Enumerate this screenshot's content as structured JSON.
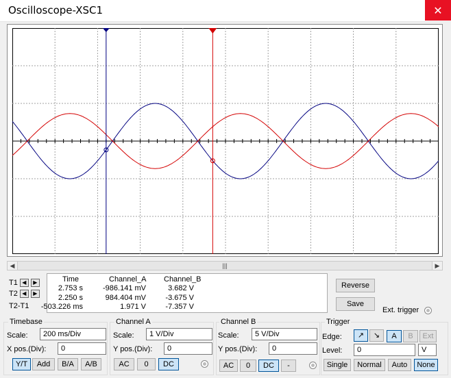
{
  "window": {
    "title": "Oscilloscope-XSC1",
    "close_glyph": "✕"
  },
  "colors": {
    "channel_a": "#000080",
    "channel_b": "#d40000",
    "cursor_1": "#000080",
    "cursor_2": "#d40000",
    "grid": "#a0a0a0",
    "close": "#e81123"
  },
  "cursors": {
    "t1_label": "T1",
    "t2_label": "T2",
    "diff_label": "T2-T1"
  },
  "measure": {
    "headers": [
      "Time",
      "Channel_A",
      "Channel_B"
    ],
    "rows": [
      [
        "2.753 s",
        "-986.141 mV",
        "3.682 V"
      ],
      [
        "2.250 s",
        "984.404 mV",
        "-3.675 V"
      ],
      [
        "-503.226 ms",
        "1.971 V",
        "-7.357 V"
      ]
    ]
  },
  "buttons": {
    "reverse": "Reverse",
    "save": "Save",
    "ext_trigger": "Ext. trigger"
  },
  "timebase": {
    "title": "Timebase",
    "scale_label": "Scale:",
    "scale_value": "200 ms/Div",
    "xpos_label": "X pos.(Div):",
    "xpos_value": "0",
    "modes": [
      "Y/T",
      "Add",
      "B/A",
      "A/B"
    ],
    "active_mode": "Y/T"
  },
  "channel_a": {
    "title": "Channel A",
    "scale_label": "Scale:",
    "scale_value": "1  V/Div",
    "ypos_label": "Y pos.(Div):",
    "ypos_value": "0",
    "coupling": [
      "AC",
      "0",
      "DC"
    ],
    "active": "DC"
  },
  "channel_b": {
    "title": "Channel B",
    "scale_label": "Scale:",
    "scale_value": "5  V/Div",
    "ypos_label": "Y pos.(Div):",
    "ypos_value": "0",
    "coupling": [
      "AC",
      "0",
      "DC",
      "-"
    ],
    "active": "DC"
  },
  "trigger": {
    "title": "Trigger",
    "edge_label": "Edge:",
    "edge_sources": [
      "A",
      "B",
      "Ext"
    ],
    "active_source": "A",
    "level_label": "Level:",
    "level_value": "0",
    "level_unit": "V",
    "modes": [
      "Single",
      "Normal",
      "Auto",
      "None"
    ],
    "active_mode": "None"
  },
  "chart_data": {
    "type": "line",
    "xlabel": "",
    "ylabel": "",
    "x_divisions": 10,
    "y_divisions": 6,
    "grid": true,
    "series": [
      {
        "name": "Channel_A",
        "color": "#000080",
        "amplitude_div": 1.0,
        "period_div": 4.0,
        "phase": "negative-sine",
        "span_div": [
          0,
          10
        ]
      },
      {
        "name": "Channel_B",
        "color": "#d40000",
        "amplitude_div": 0.73,
        "period_div": 4.0,
        "phase": "positive-sine",
        "span_div": [
          0,
          10
        ]
      }
    ],
    "cursor_1_div": 2.2,
    "cursor_2_div": 4.7
  }
}
